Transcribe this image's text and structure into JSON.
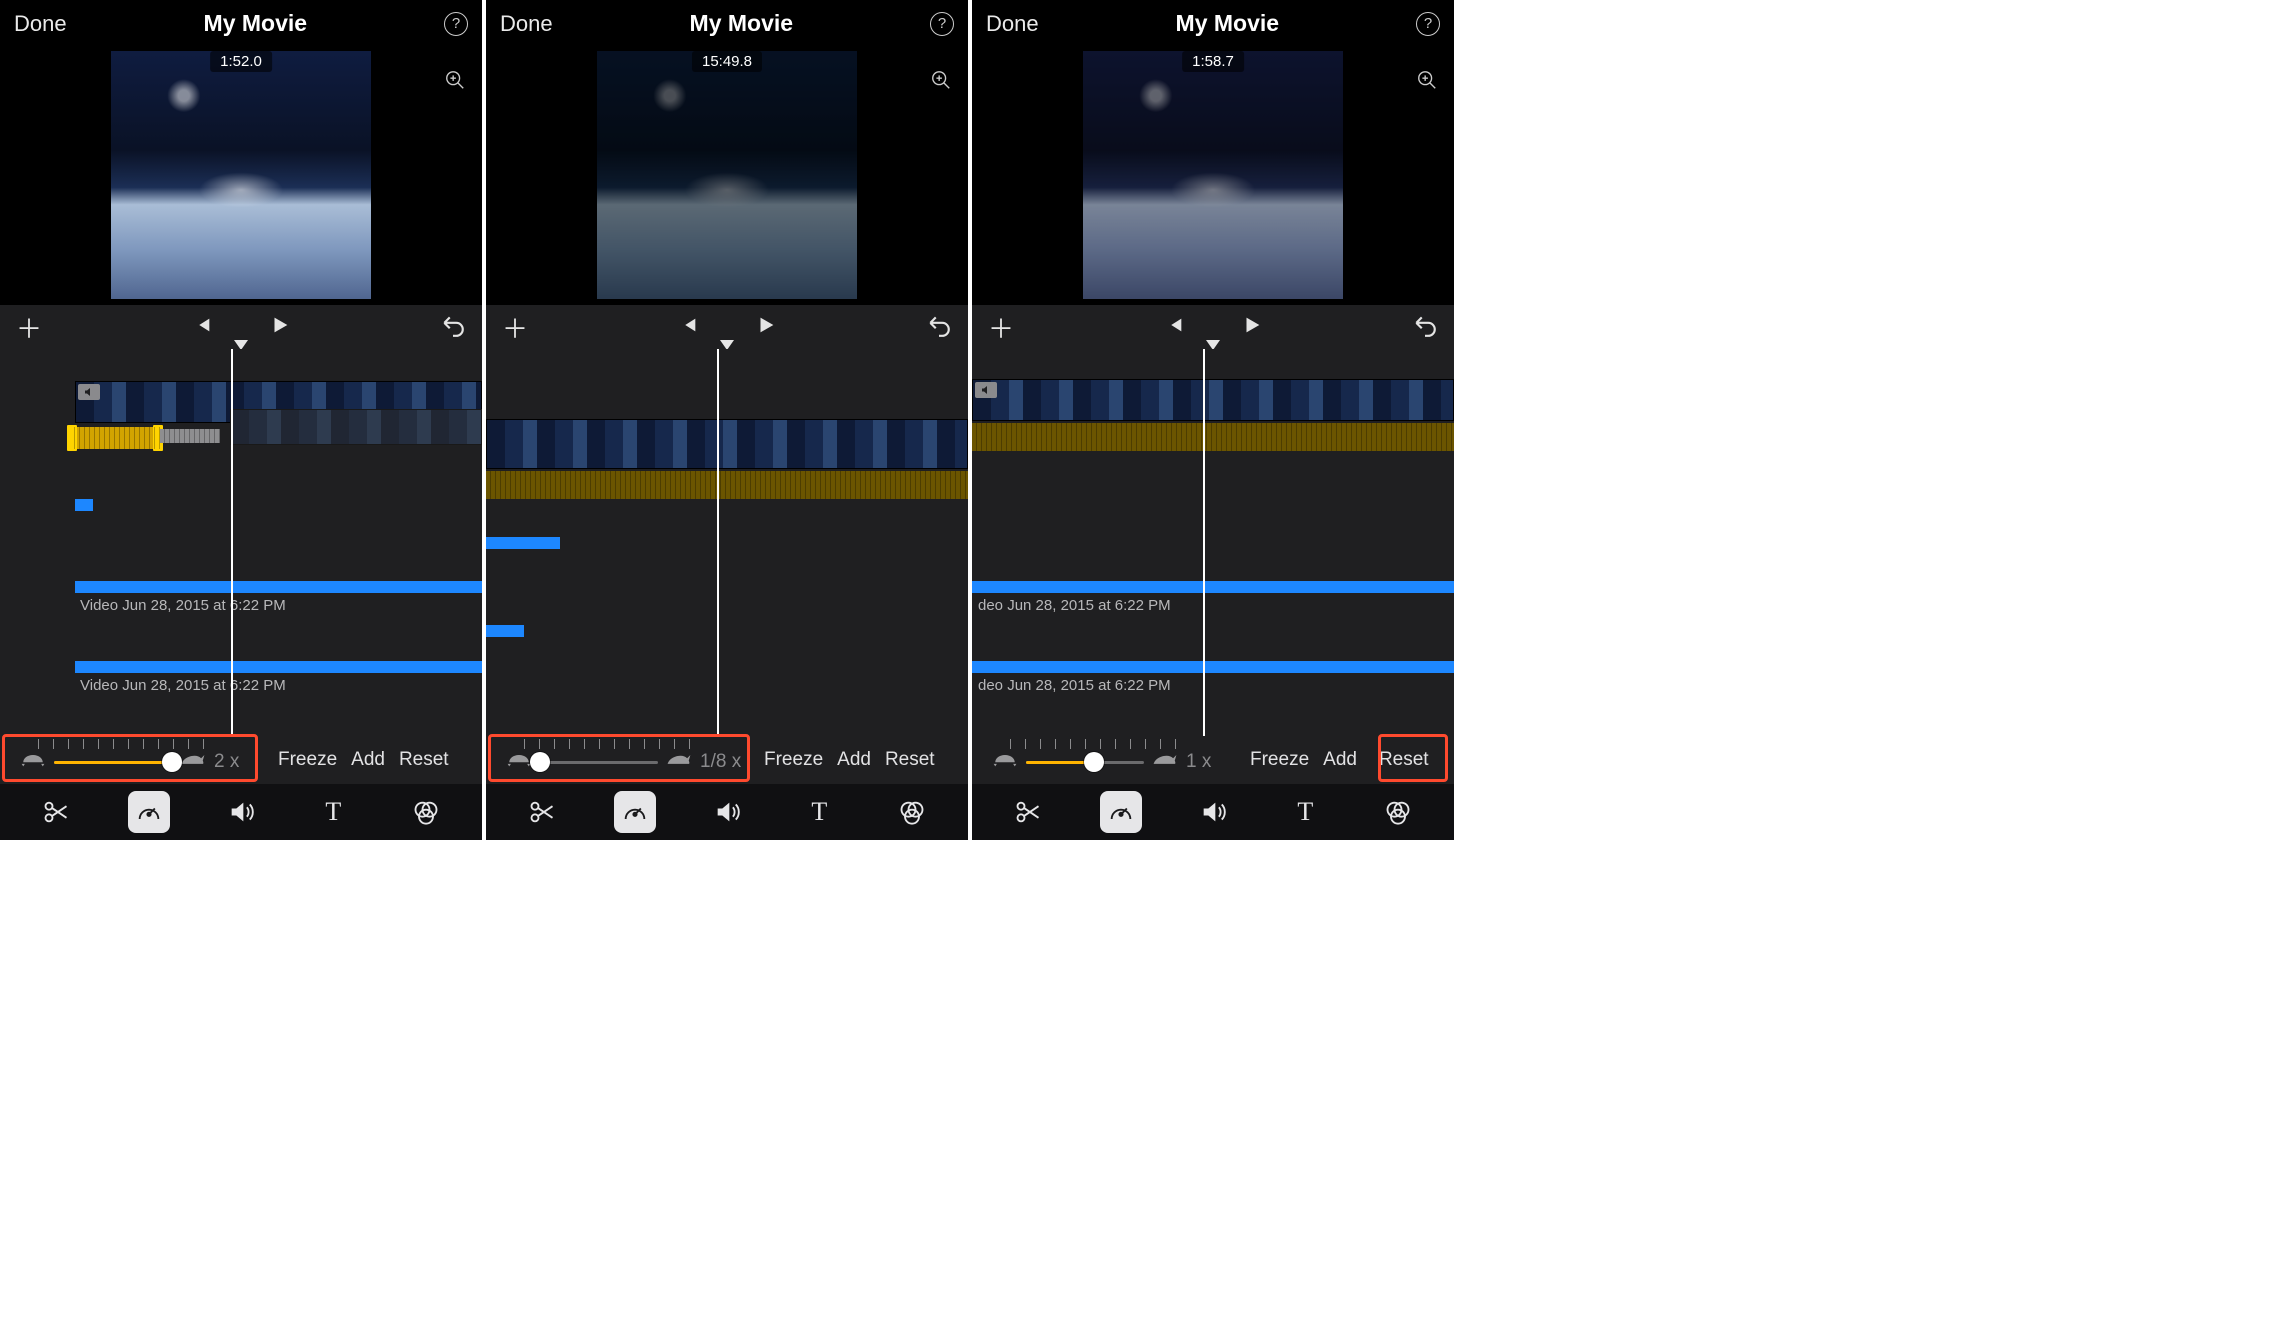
{
  "panels": [
    {
      "done": "Done",
      "title": "My Movie",
      "timecode": "1:52.0",
      "speed_value": "2 x",
      "freeze": "Freeze",
      "add": "Add",
      "reset": "Reset",
      "clip_label_1": "Video Jun 28, 2015 at 6:22 PM",
      "clip_label_2": "Video Jun 28, 2015 at 6:22 PM",
      "slider_pct": 100,
      "playhead_pct": 48,
      "highlight": "speed"
    },
    {
      "done": "Done",
      "title": "My Movie",
      "timecode": "15:49.8",
      "speed_value": "1/8 x",
      "freeze": "Freeze",
      "add": "Add",
      "reset": "Reset",
      "clip_label_1": "",
      "clip_label_2": "",
      "slider_pct": 0,
      "playhead_pct": 48,
      "highlight": "speed"
    },
    {
      "done": "Done",
      "title": "My Movie",
      "timecode": "1:58.7",
      "speed_value": "1 x",
      "freeze": "Freeze",
      "add": "Add",
      "reset": "Reset",
      "clip_label_1": "deo Jun 28, 2015 at 6:22 PM",
      "clip_label_2": "deo Jun 28, 2015 at 6:22 PM",
      "slider_pct": 58,
      "playhead_pct": 48,
      "highlight": "reset"
    }
  ]
}
